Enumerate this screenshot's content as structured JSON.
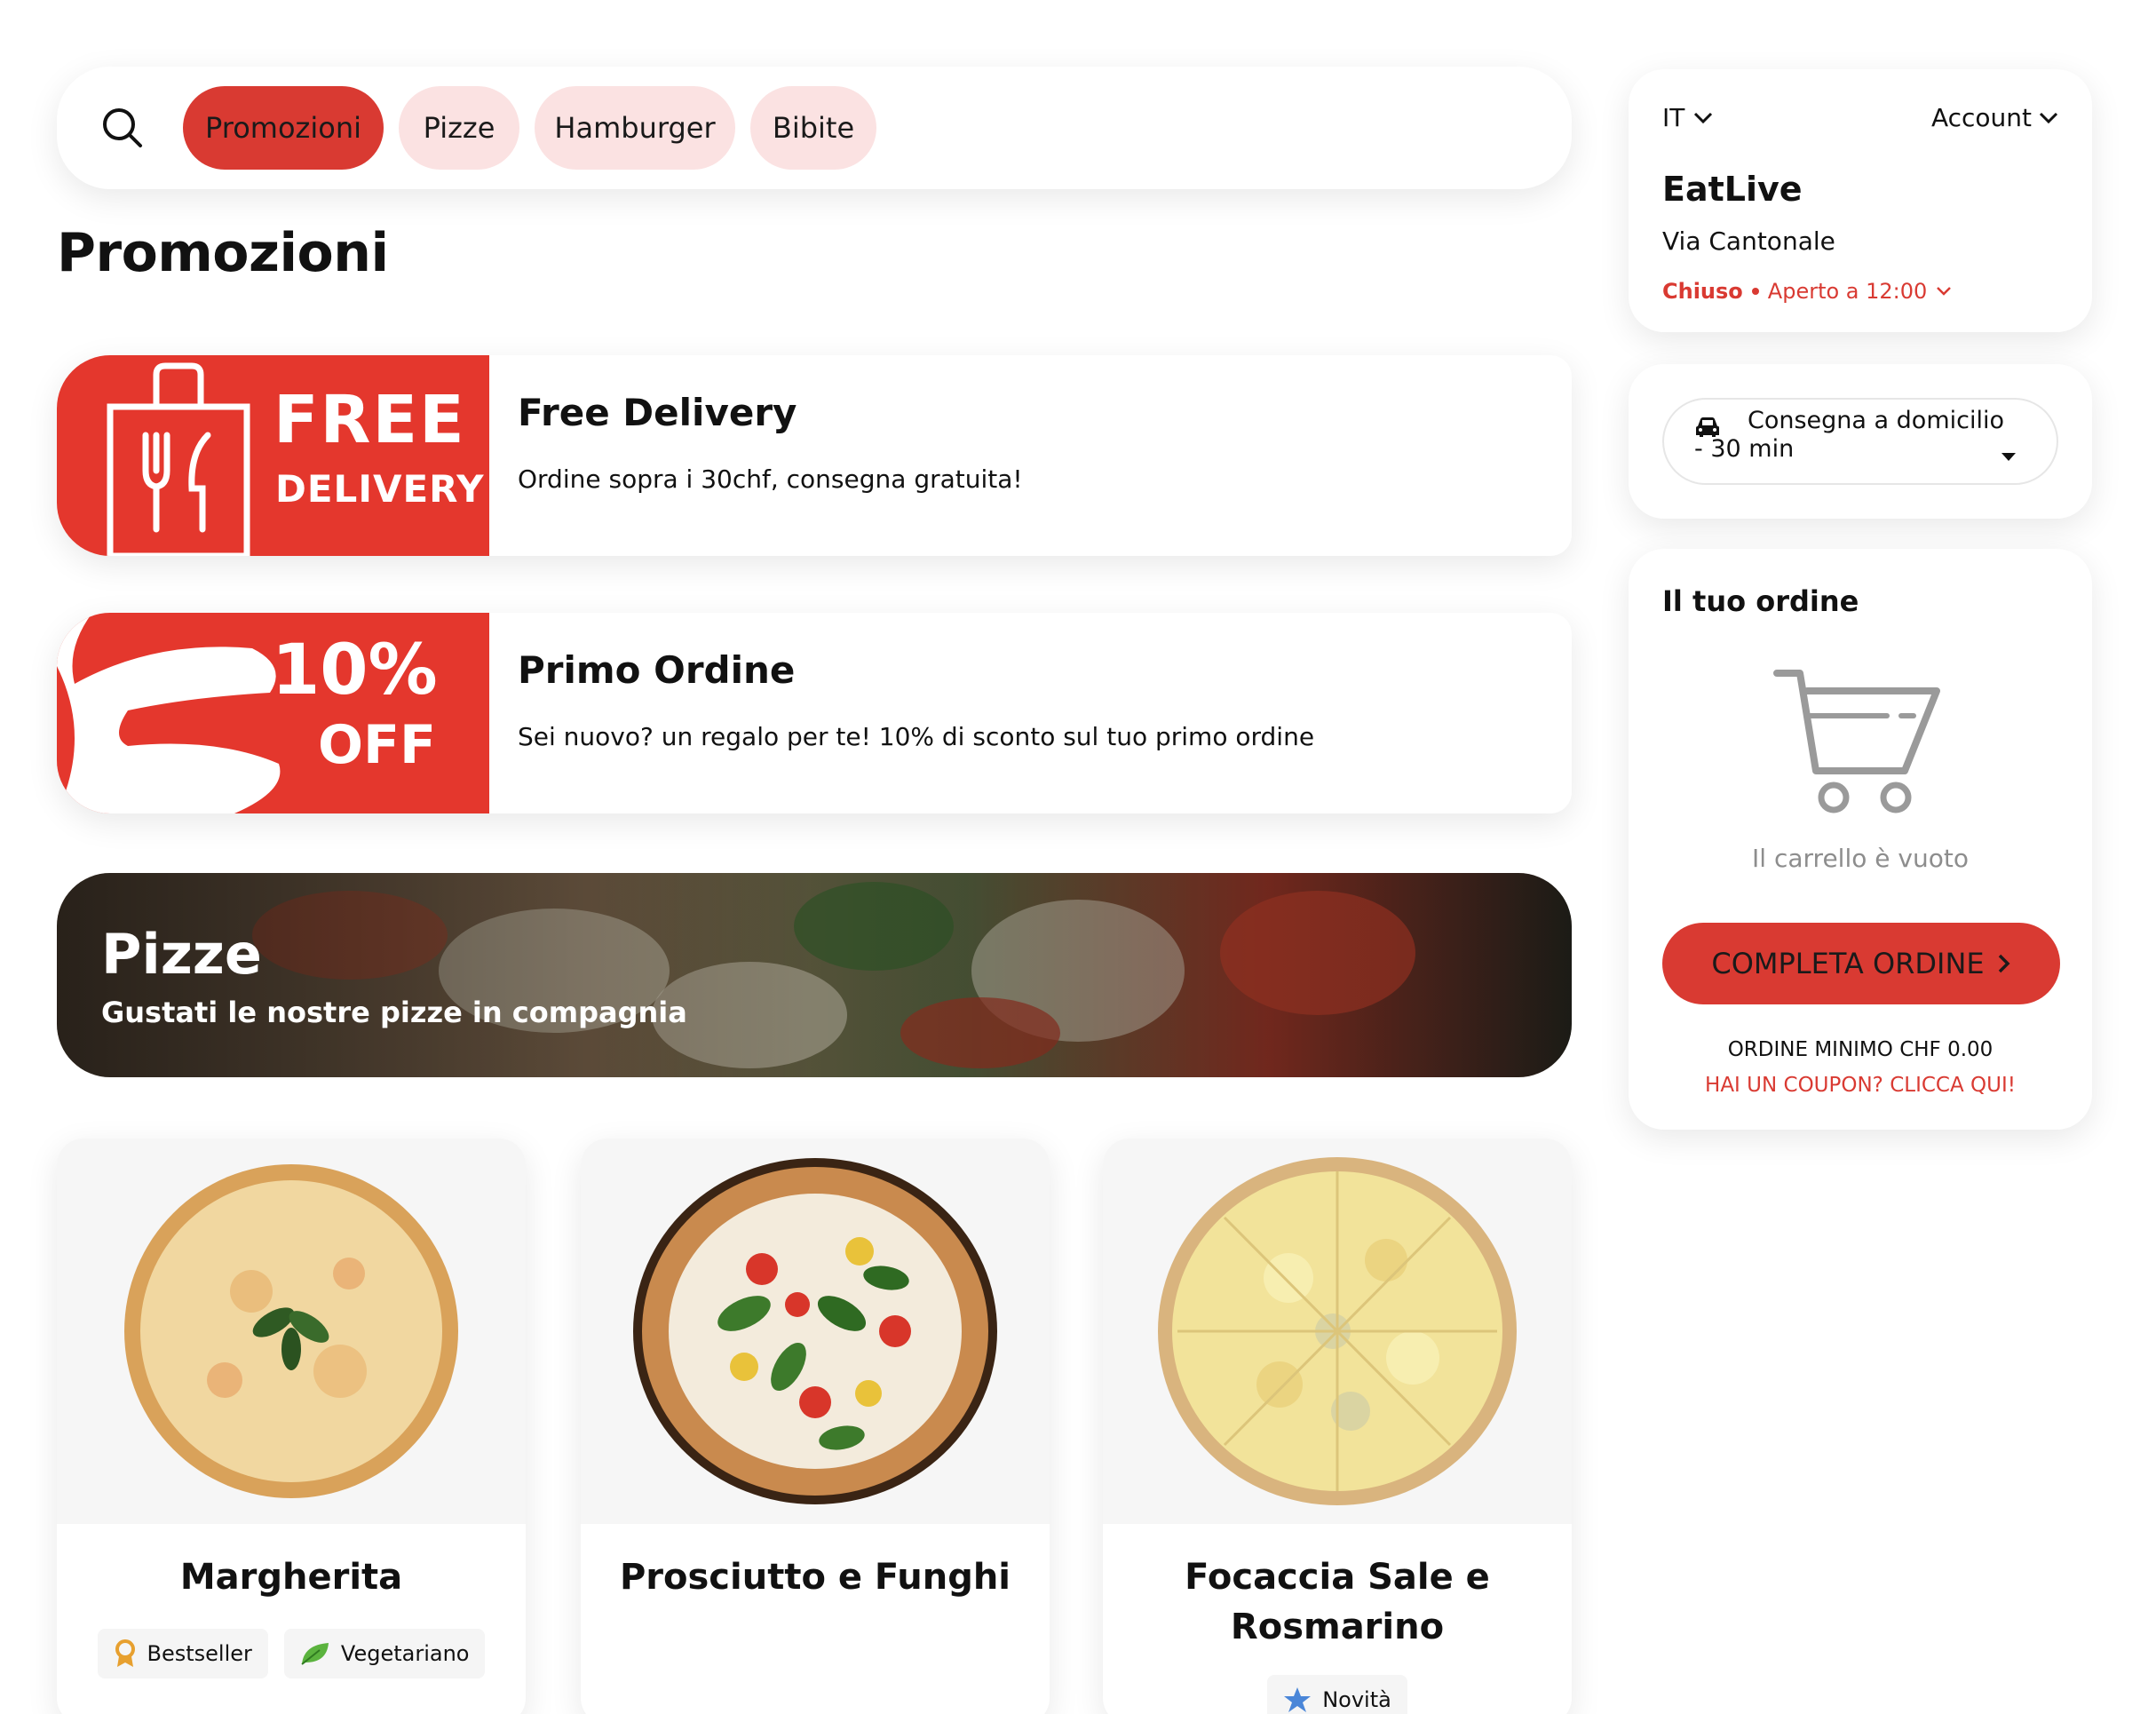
{
  "nav": {
    "categories": [
      {
        "label": "Promozioni",
        "active": true
      },
      {
        "label": "Pizze",
        "active": false
      },
      {
        "label": "Hamburger",
        "active": false
      },
      {
        "label": "Bibite",
        "active": false
      }
    ]
  },
  "section_title": "Promozioni",
  "promos": [
    {
      "badge_line1": "FREE",
      "badge_line2": "DELIVERY",
      "title": "Free Delivery",
      "description": "Ordine sopra i 30chf, consegna gratuita!"
    },
    {
      "badge_line1": "10%",
      "badge_line2": "OFF",
      "title": "Primo Ordine",
      "description": "Sei nuovo? un regalo per te! 10% di sconto sul tuo primo ordine"
    }
  ],
  "banner": {
    "title": "Pizze",
    "subtitle": "Gustati le nostre pizze in compagnia"
  },
  "products": [
    {
      "name": "Margherita",
      "tags": [
        "Bestseller",
        "Vegetariano"
      ]
    },
    {
      "name": "Prosciutto e Funghi",
      "tags": []
    },
    {
      "name": "Focaccia Sale e Rosmarino",
      "tags": [
        "Novità"
      ]
    }
  ],
  "store": {
    "language": "IT",
    "account_label": "Account",
    "name": "EatLive",
    "address": "Via Cantonale",
    "status_closed": "Chiuso",
    "status_open_at": "Aperto a 12:00"
  },
  "delivery": {
    "selected": "Consegna a domicilio - 30 min"
  },
  "order": {
    "title": "Il tuo ordine",
    "empty_text": "Il carrello è vuoto",
    "complete_label": "COMPLETA ORDINE",
    "minimum_text": "ORDINE MINIMO CHF 0.00",
    "coupon_text": "HAI UN COUPON? CLICCA QUI!"
  },
  "colors": {
    "accent": "#d93a32",
    "pill": "#fbe2e2",
    "badge_red": "#e4372d"
  },
  "icons": [
    "search-icon",
    "chevron-down-icon",
    "shopping-bag-icon",
    "car-icon",
    "cart-icon",
    "chevron-right-icon",
    "award-icon",
    "leaf-icon",
    "star-icon"
  ]
}
